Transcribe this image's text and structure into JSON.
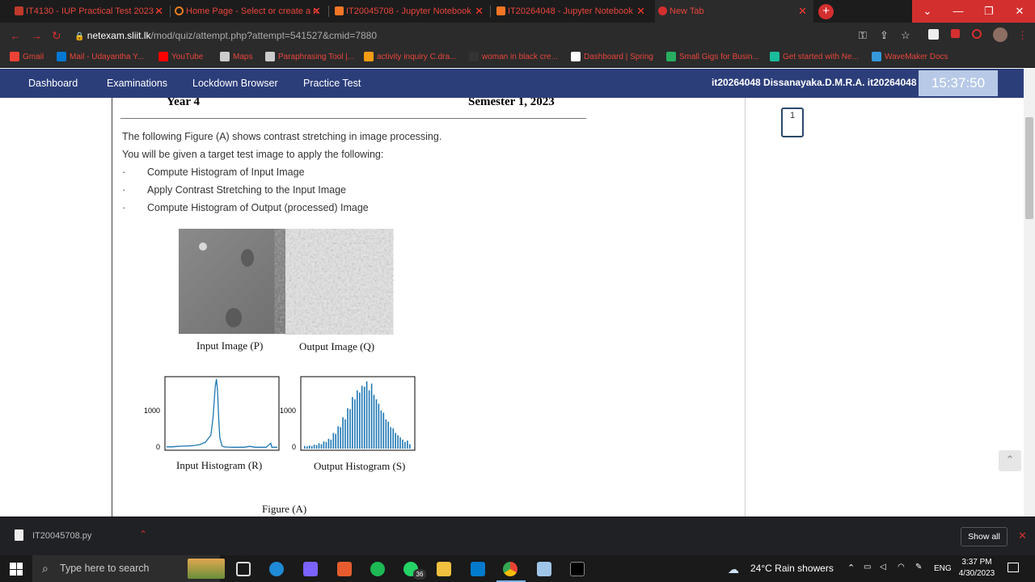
{
  "browser": {
    "tabs": [
      {
        "title": "IT4130 - IUP Practical Test 2023 -"
      },
      {
        "title": "Home Page - Select or create a n"
      },
      {
        "title": "IT20045708 - Jupyter Notebook"
      },
      {
        "title": "IT20264048 - Jupyter Notebook"
      },
      {
        "title": "New Tab"
      }
    ],
    "new_tab": "+",
    "url_host": "netexam.sliit.lk",
    "url_path": "/mod/quiz/attempt.php?attempt=541527&cmid=7880",
    "bookmarks": [
      {
        "label": "Gmail",
        "color": "#ea4335"
      },
      {
        "label": "Mail - Udayantha Y...",
        "color": "#0078d4"
      },
      {
        "label": "YouTube",
        "color": "#ff0000"
      },
      {
        "label": "Maps",
        "color": "#cccccc"
      },
      {
        "label": "Paraphrasing Tool |...",
        "color": "#cccccc"
      },
      {
        "label": "activity inquiry C.dra...",
        "color": "#f39c12"
      },
      {
        "label": "woman in black cre...",
        "color": "#333333"
      },
      {
        "label": "Dashboard | Spring",
        "color": "#ffffff"
      },
      {
        "label": "Small Gigs for Busin...",
        "color": "#27ae60"
      },
      {
        "label": "Get started with Ne...",
        "color": "#1abc9c"
      },
      {
        "label": "WaveMaker Docs",
        "color": "#3498db"
      }
    ]
  },
  "site": {
    "nav": [
      "Dashboard",
      "Examinations",
      "Lockdown Browser",
      "Practice Test"
    ],
    "user": "it20264048 Dissanayaka.D.M.R.A. it20264048",
    "timer": "15:37:50",
    "quiz_nav_number": "1"
  },
  "question": {
    "header_left": "Year 4",
    "header_right": "Semester 1, 2023",
    "intro1": "The following Figure (A) shows contrast stretching in image processing.",
    "intro2": "You will be given a target test image to apply the following:",
    "bullet_mark": "·",
    "bullets": [
      "Compute Histogram of Input Image",
      "Apply Contrast Stretching to the Input Image",
      "Compute Histogram of Output (processed) Image"
    ],
    "cap_p": "Input Image (P)",
    "cap_q": "Output Image (Q)",
    "cap_r": "Input Histogram (R)",
    "cap_s": "Output Histogram (S)",
    "figure_caption": "Figure (A)",
    "tick_1000": "1000",
    "tick_0": "0"
  },
  "chart_data": [
    {
      "type": "line",
      "title": "Input Histogram (R)",
      "yticks": [
        0,
        1000
      ],
      "ylim": [
        0,
        1550
      ],
      "x": [
        0,
        5,
        10,
        15,
        20,
        25,
        30,
        35,
        40,
        42,
        44,
        45,
        46,
        47,
        48,
        50,
        52,
        55,
        60,
        70,
        75,
        80,
        90,
        94,
        95,
        96,
        100
      ],
      "values": [
        40,
        40,
        50,
        55,
        60,
        70,
        90,
        140,
        300,
        700,
        1400,
        1550,
        1300,
        700,
        250,
        60,
        40,
        35,
        30,
        30,
        50,
        30,
        30,
        120,
        30,
        30,
        30
      ]
    },
    {
      "type": "bar",
      "title": "Output Histogram (S)",
      "yticks": [
        0,
        1000
      ],
      "ylim": [
        0,
        1550
      ],
      "values": [
        60,
        50,
        70,
        60,
        90,
        80,
        120,
        100,
        160,
        150,
        220,
        200,
        350,
        330,
        500,
        480,
        700,
        650,
        900,
        880,
        1150,
        1100,
        1300,
        1250,
        1400,
        1380,
        1500,
        1300,
        1450,
        1200,
        1100,
        1000,
        850,
        800,
        650,
        600,
        480,
        450,
        350,
        300,
        250,
        200,
        150,
        180,
        100
      ]
    }
  ],
  "downloads": {
    "file": "IT20045708.py",
    "show_all": "Show all"
  },
  "taskbar": {
    "search_placeholder": "Type here to search",
    "whatsapp_badge": "36",
    "weather": "24°C  Rain showers",
    "lang": "ENG",
    "time": "3:37 PM",
    "date": "4/30/2023"
  }
}
